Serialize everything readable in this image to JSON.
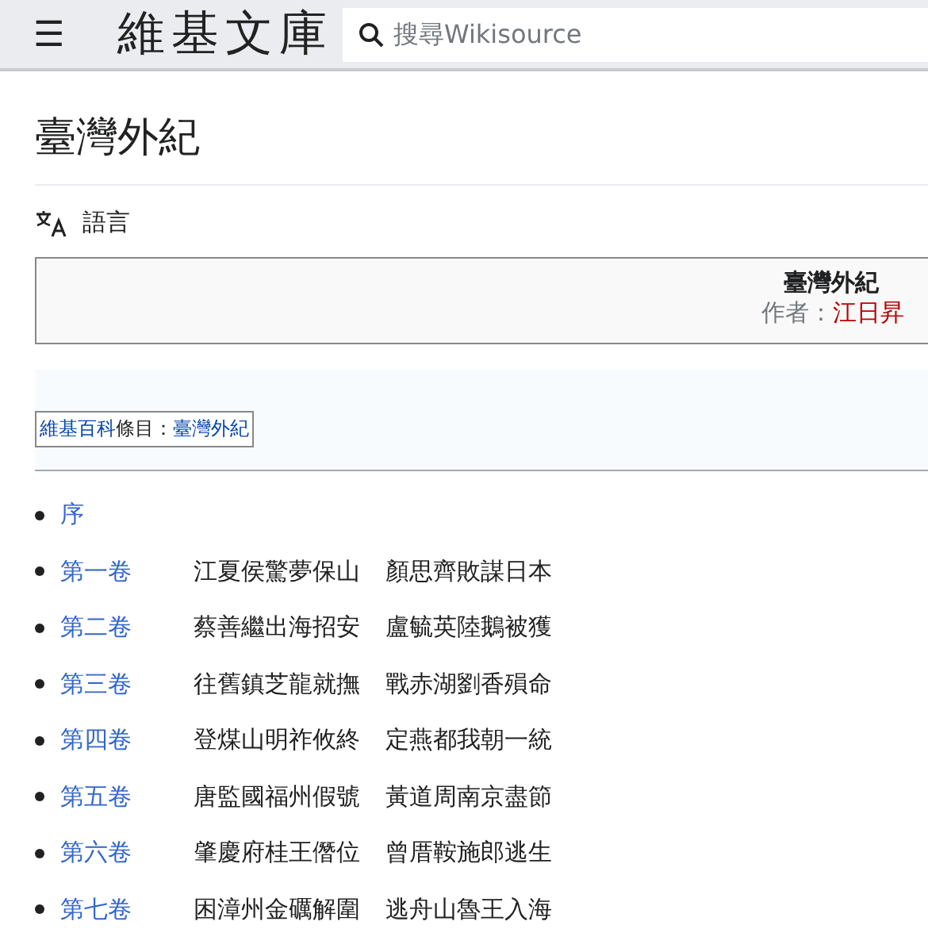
{
  "header": {
    "menu_icon": "☰",
    "logo": "維基文庫",
    "search": {
      "placeholder": "搜尋Wikisource"
    }
  },
  "page_title": "臺灣外紀",
  "language_button": "語言",
  "header_box": {
    "title": "臺灣外紀",
    "author_label": "作者：",
    "author": "江日昇"
  },
  "wikipedia_note": {
    "link": "維基百科",
    "label": "條目：",
    "article": "臺灣外紀"
  },
  "chapters": [
    {
      "label": "序"
    },
    {
      "label": "第一卷",
      "lines": [
        "江夏侯驚夢保山",
        "顏思齊敗謀日本"
      ]
    },
    {
      "label": "第二卷",
      "lines": [
        "蔡善繼出海招安",
        "盧毓英陸鵝被獲"
      ]
    },
    {
      "label": "第三卷",
      "lines": [
        "往舊鎮芝龍就撫",
        "戰赤湖劉香殞命"
      ]
    },
    {
      "label": "第四卷",
      "lines": [
        "登煤山明祚攸終",
        "定燕都我朝一統"
      ]
    },
    {
      "label": "第五卷",
      "lines": [
        "唐監國福州假號",
        "黃道周南京盡節"
      ]
    },
    {
      "label": "第六卷",
      "lines": [
        "肇慶府桂王僭位",
        "曾厝鞍施郎逃生"
      ]
    },
    {
      "label": "第七卷",
      "lines": [
        "困漳州金礪解圍",
        "逃舟山魯王入海"
      ]
    }
  ]
}
